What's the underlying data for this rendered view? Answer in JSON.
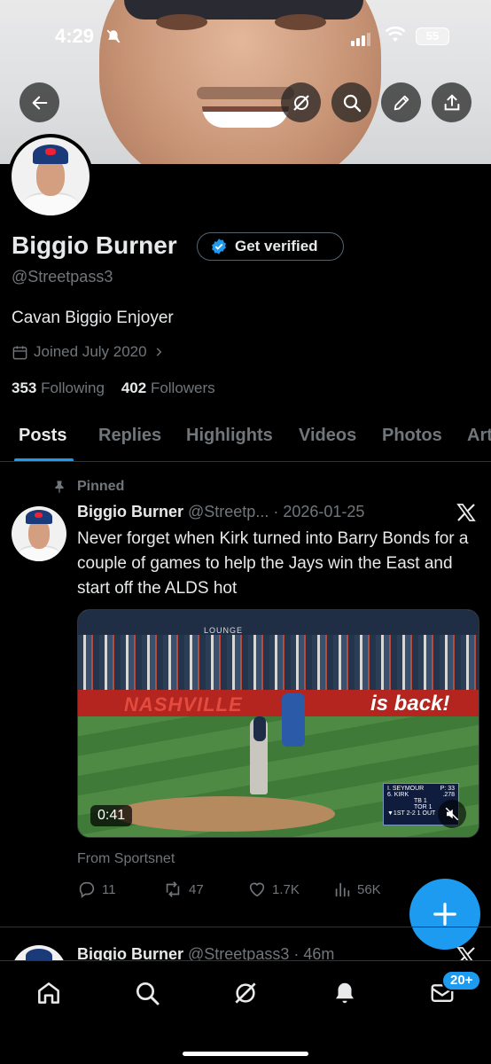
{
  "status_bar": {
    "time": "4:29",
    "battery": "55"
  },
  "profile": {
    "name": "Biggio Burner",
    "verify_label": "Get verified",
    "handle": "@Streetpass3",
    "bio": "Cavan Biggio Enjoyer",
    "joined": "Joined July 2020",
    "following_count": "353",
    "following_label": "Following",
    "followers_count": "402",
    "followers_label": "Followers"
  },
  "tabs": [
    {
      "label": "Posts",
      "active": true
    },
    {
      "label": "Replies"
    },
    {
      "label": "Highlights"
    },
    {
      "label": "Videos"
    },
    {
      "label": "Photos"
    },
    {
      "label": "Art"
    }
  ],
  "pinned_post": {
    "pinned_label": "Pinned",
    "author": "Biggio Burner",
    "handle_date": "@Streetp... · 2026-01-25",
    "text": "Never forget when Kirk turned into Barry Bonds for a couple of games to help the Jays win the East and start off the ALDS hot",
    "video": {
      "duration": "0:41",
      "lounge_text": "LOUNGE",
      "ad_left": "NASHVILLE",
      "ad_right": "is back!",
      "score": {
        "pitcher": "I. SEYMOUR",
        "pitch": "P: 33",
        "batter": "6. KIRK",
        "avg": ".278",
        "away": "TB",
        "away_score": "1",
        "home": "TOR",
        "home_score": "1",
        "inning": "▼1ST",
        "count": "2-2",
        "outs": "1 OUT"
      }
    },
    "source": "From Sportsnet",
    "replies": "11",
    "reposts": "47",
    "likes": "1.7K",
    "views": "56K"
  },
  "next_post": {
    "author": "Biggio Burner",
    "handle_time": "@Streetpass3 · 46m"
  },
  "bottom_nav": {
    "messages_badge": "20+"
  },
  "colors": {
    "accent": "#1d9bf0",
    "background": "#000000",
    "muted": "#71767b",
    "text": "#e7e9ea"
  }
}
